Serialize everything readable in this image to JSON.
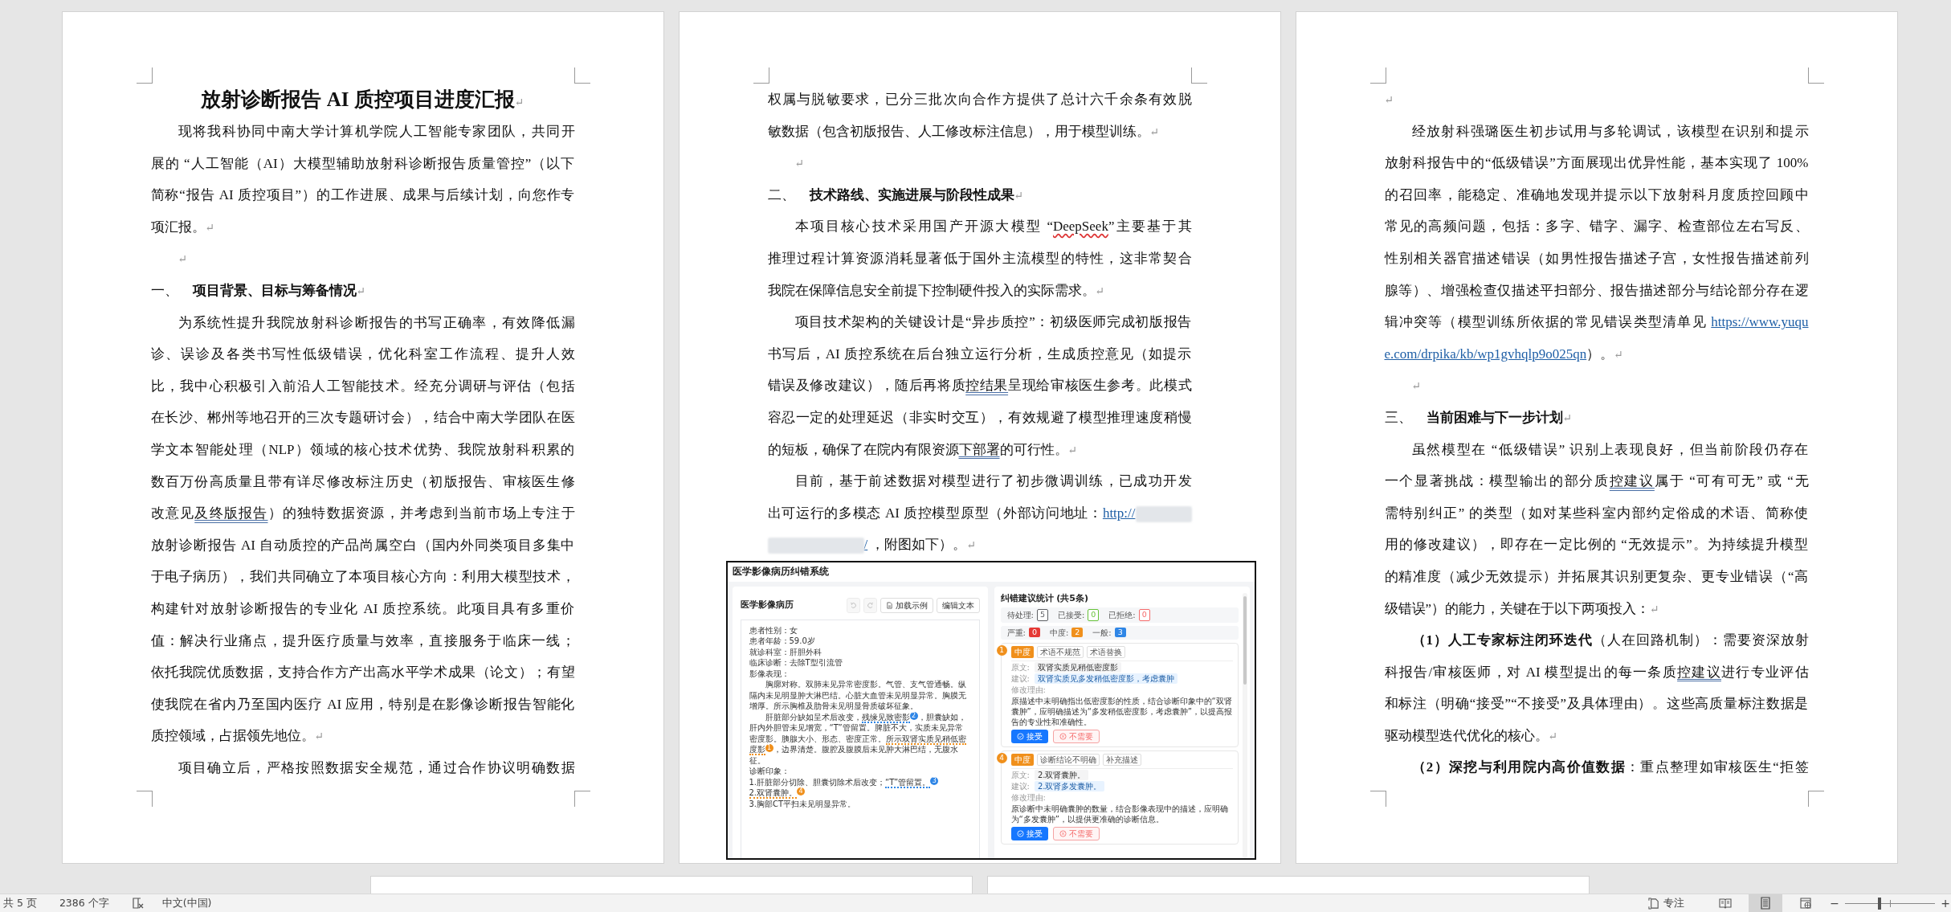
{
  "pages": [
    {
      "paragraphs": [
        {
          "kind": "title",
          "text": "放射诊断报告 AI 质控项目进度汇报",
          "end_mark": "↵"
        },
        {
          "kind": "body",
          "indent": true,
          "lines": [
            "现将我科协同中南大学计算机学院人工智能专家团队，共同开",
            "展的 “人工智能（AI）大模型辅助放射科诊断报告质量管控”（以下",
            "简称“报告 AI 质控项目”）的工作进展、成果与后续计划，向您作专",
            "项汇报。"
          ],
          "end_mark": "↵"
        },
        {
          "kind": "blank",
          "indent": true,
          "end_mark": "↵"
        },
        {
          "kind": "heading",
          "number": "一、",
          "text": "项目背景、目标与筹备情况",
          "end_mark": "↵"
        },
        {
          "kind": "body",
          "indent": true,
          "lines": [
            "为系统性提升我院放射科诊断报告的书写正确率，有效降低漏",
            "诊、误诊及各类书写性低级错误，优化科室工作流程、提升人效",
            "比，我中心积极引入前沿人工智能技术。经充分调研与评估（包括",
            "在长沙、郴州等地召开的三次专题研讨会），结合中南大学团队在医",
            "学文本智能处理（NLP）领域的核心技术优势、我院放射科积累的",
            "数百万份高质量且带有详尽修改标注历史（初版报告、审核医生修",
            [
              "改意见",
              {
                "text": "及终版报告",
                "kind": "grammar"
              },
              "）的独特数据资源，并考虑到当前市场上专注于"
            ],
            "放射诊断报告 AI 自动质控的产品尚属空白（国内外同类项目多集中",
            "于电子病历），我们共同确立了本项目核心方向：利用大模型技术，",
            "构建针对放射诊断报告的专业化 AI 质控系统。此项目具有多重价",
            "值：解决行业痛点，提升医疗质量与效率，直接服务于临床一线；",
            "依托我院优质数据，支持合作方产出高水平学术成果（论文）；有望",
            "使我院在省内乃至国内医疗 AI 应用，特别是在影像诊断报告智能化",
            "质控领域，占据领先地位。"
          ],
          "end_mark": "↵"
        },
        {
          "kind": "body",
          "indent": true,
          "lines": [
            "项目确立后，严格按照数据安全规范，通过合作协议明确数据"
          ]
        }
      ]
    },
    {
      "paragraphs": [
        {
          "kind": "body",
          "indent": false,
          "lines": [
            "权属与脱敏要求，已分三批次向合作方提供了总计六千余条有效脱",
            "敏数据（包含初版报告、人工修改标注信息），用于模型训练。"
          ],
          "end_mark": "↵"
        },
        {
          "kind": "blank",
          "indent": true,
          "end_mark": "↵"
        },
        {
          "kind": "heading",
          "number": "二、",
          "text": "技术路线、实施进展与阶段性成果",
          "end_mark": "↵"
        },
        {
          "kind": "body",
          "indent": true,
          "lines": [
            [
              "本项目核心技术采用国产开源大模型 “",
              {
                "text": "DeepSeek",
                "kind": "spelling"
              },
              "”主要基于其"
            ],
            "推理过程计算资源消耗显著低于国外主流模型的特性，这非常契合",
            "我院在保障信息安全前提下控制硬件投入的实际需求。"
          ],
          "end_mark": "↵"
        },
        {
          "kind": "body",
          "indent": true,
          "lines": [
            "项目技术架构的关键设计是“异步质控”：初级医师完成初版报告",
            "书写后，AI 质控系统在后台独立运行分析，生成质控意见（如提示",
            [
              "错误及修改建议），随后再将质",
              {
                "text": "控结果",
                "kind": "grammar"
              },
              "呈现给审核医生参考。此模式"
            ],
            "容忍一定的处理延迟（非实时交互），有效规避了模型推理速度稍慢",
            [
              "的短板，确保了在院内有限资源",
              {
                "text": "下部署",
                "kind": "grammar"
              },
              "的可行性。"
            ]
          ],
          "end_mark": "↵"
        },
        {
          "kind": "body",
          "indent": true,
          "lines": [
            "目前，基于前述数据对模型进行了初步微调训练，已成功开发",
            [
              "出可运行的多模态 AI 质控模型原型（外部访问地址：",
              {
                "text": "http://",
                "kind": "link"
              },
              {
                "kind": "blur"
              }
            ],
            [
              {
                "kind": "blur"
              },
              {
                "text": "/",
                "kind": "link"
              },
              "  ，附图如下）。"
            ]
          ],
          "end_mark": "↵"
        }
      ],
      "figure": {
        "app_title": "医学影像病历纠错系统",
        "editor": {
          "title": "医学影像病历",
          "buttons": [
            {
              "kind": "undo",
              "disabled": true
            },
            {
              "kind": "redo",
              "disabled": true
            },
            {
              "kind": "load",
              "label": "加载示例",
              "disabled": false
            },
            {
              "kind": "edit",
              "label": "编辑文本",
              "disabled": false
            }
          ],
          "lines": [
            {
              "indent": false,
              "parts": [
                {
                  "text": "患者性别：女",
                  "flag": false
                }
              ]
            },
            {
              "indent": false,
              "parts": [
                {
                  "text": "患者年龄：59.0岁",
                  "flag": false
                }
              ]
            },
            {
              "indent": false,
              "parts": [
                {
                  "text": "就诊科室：肝胆外科",
                  "flag": false
                }
              ]
            },
            {
              "indent": false,
              "parts": [
                {
                  "text": "临床诊断：去除T型引流管",
                  "flag": false
                }
              ]
            },
            {
              "indent": false,
              "parts": [
                {
                  "text": "影像表现：",
                  "flag": false
                }
              ]
            },
            {
              "indent": true,
              "parts": [
                {
                  "text": "胸廓对称。双肺未见异常密度影。气管、支气管通畅。纵隔内未见明显肿大淋巴结。心脏大血管未见明显异常。胸膜无增厚。所示胸椎及肋骨未见明显骨质破坏征象。",
                  "flag": false
                }
              ]
            },
            {
              "indent": true,
              "parts": [
                {
                  "text": "肝脏部分缺如呈术后改变，",
                  "flag": false
                },
                {
                  "text": "残缘见致密影",
                  "flag": true
                },
                {
                  "badge": "2",
                  "color": "#2f86e6"
                },
                {
                  "text": "，胆囊缺如，肝内外胆管未见增宽，“T”管留置。脾脏不大，实质未见异常密度影。胰腺大小、形态、密度正常。",
                  "flag": false
                },
                {
                  "text": "所示双肾实质见稍低密度影",
                  "flag": true
                },
                {
                  "badge": "1",
                  "color": "#f0901c"
                },
                {
                  "text": "，边界清楚。腹腔及腹膜后未见肿大淋巴结，无腹水征。",
                  "flag": false
                }
              ]
            },
            {
              "indent": false,
              "parts": [
                {
                  "text": "诊断印象：",
                  "flag": false
                }
              ]
            },
            {
              "indent": false,
              "parts": [
                {
                  "text": "1.肝脏部分切除、胆囊切除术后改变；",
                  "flag": false
                },
                {
                  "text": "“T”管留置。",
                  "flag": true
                },
                {
                  "badge": "3",
                  "color": "#2f86e6"
                }
              ]
            },
            {
              "indent": false,
              "parts": [
                {
                  "text": "2.双肾囊肿。",
                  "flag": true
                },
                {
                  "badge": "4",
                  "color": "#f0901c"
                }
              ]
            },
            {
              "indent": false,
              "parts": [
                {
                  "text": "3.胸部CT平扫未见明显异常。",
                  "flag": false
                }
              ]
            }
          ]
        },
        "suggestions": {
          "title": "纠错建议统计 (共5条)",
          "stats": [
            {
              "label": "待处理:",
              "count": "5",
              "color": "#606266"
            },
            {
              "label": "已接受:",
              "count": "0",
              "color": "#67c23a"
            },
            {
              "label": "已拒绝:",
              "count": "0",
              "color": "#f56c6c"
            }
          ],
          "severity": [
            {
              "label": "严重:",
              "count": "0",
              "color": "#e53935"
            },
            {
              "label": "中度:",
              "count": "2",
              "color": "#f0901c"
            },
            {
              "label": "一般:",
              "count": "3",
              "color": "#2f86e6"
            }
          ],
          "cards": [
            {
              "number": "1",
              "color": "#f0901c",
              "severity": "中度",
              "tags": [
                "术语不规范",
                "术语替换"
              ],
              "original_label": "原文:",
              "original": "双肾实质见稍低密度影",
              "suggest_label": "建议:",
              "suggestion": "双肾实质见多发稍低密度影，考虑囊肿",
              "reason_label": "修改理由:",
              "reason": "原描述中未明确指出低密度影的性质，结合诊断印象中的“双肾囊肿”，应明确描述为“多发稍低密度影，考虑囊肿”，以提高报告的专业性和准确性。",
              "accept": "接受",
              "reject": "不需要"
            },
            {
              "number": "4",
              "color": "#f0901c",
              "severity": "中度",
              "tags": [
                "诊断结论不明确",
                "补充描述"
              ],
              "original_label": "原文:",
              "original": "2.双肾囊肿。",
              "suggest_label": "建议:",
              "suggestion": "2.双肾多发囊肿。",
              "reason_label": "修改理由:",
              "reason": "原诊断中未明确囊肿的数量，结合影像表现中的描述，应明确为“多发囊肿”，以提供更准确的诊断信息。",
              "accept": "接受",
              "reject": "不需要"
            }
          ]
        }
      }
    },
    {
      "paragraphs": [
        {
          "kind": "blank",
          "indent": false,
          "end_mark": "↵"
        },
        {
          "kind": "body",
          "indent": true,
          "lines": [
            "经放射科强璐医生初步试用与多轮调试，该模型在识别和提示",
            "放射科报告中的“低级错误”方面展现出优异性能，基本实现了 100%",
            "的召回率，能稳定、准确地发现并提示以下放射科月度质控回顾中",
            "常见的高频问题，包括：多字、错字、漏字、检查部位左右写反、",
            "性别相关器官描述错误（如男性报告描述子宫，女性报告描述前列",
            "腺等）、增强检查仅描述平扫部分、报告描述部分与结论部分存在逻",
            [
              "辑冲突等（模型训练所依据的常见错误类型清单见 ",
              {
                "text": "https://www.yuqu",
                "kind": "link"
              }
            ],
            [
              {
                "text": "e.com/drpika/kb/wp1gvhqlp9o025qn",
                "kind": "link"
              },
              "）。"
            ]
          ],
          "end_mark": "↵"
        },
        {
          "kind": "blank",
          "indent": true,
          "end_mark": "↵"
        },
        {
          "kind": "heading",
          "number": "三、",
          "text": "当前困难与下一步计划",
          "end_mark": "↵"
        },
        {
          "kind": "body",
          "indent": true,
          "lines": [
            "虽然模型在 “低级错误” 识别上表现良好，但当前阶段仍存在",
            [
              "一个显著挑战：模型输出的部分质",
              {
                "text": "控建议",
                "kind": "grammar"
              },
              "属于 “可有可无” 或 “无"
            ],
            "需特别纠正” 的类型（如对某些科室内部约定俗成的术语、简称使",
            "用的修改建议），即存在一定比例的 “无效提示”。为持续提升模型",
            "的精准度（减少无效提示）并拓展其识别更复杂、更专业错误（“高",
            "级错误”）的能力，关键在于以下两项投入："
          ],
          "end_mark": "↵"
        },
        {
          "kind": "body",
          "indent": true,
          "lines": [
            [
              {
                "text": "（1）人工专家标注闭环迭代",
                "kind": "bold"
              },
              "（人在回路机制）：需要资深放射"
            ],
            [
              "科报告/审核医师，对 AI 模型提出的每一条质",
              {
                "text": "控建议",
                "kind": "grammar"
              },
              "进行专业评估"
            ],
            "和标注（明确“接受”“不接受”及具体理由）。这些高质量标注数据是",
            "驱动模型迭代优化的核心。"
          ],
          "end_mark": "↵"
        },
        {
          "kind": "body",
          "indent": true,
          "lines": [
            [
              {
                "text": "（2）深挖与利用院内高价值数据",
                "kind": "bold"
              },
              "：重点整理如审核医生“拒签"
            ]
          ]
        }
      ]
    }
  ],
  "status_bar": {
    "page_count": "共 5 页",
    "word_count": "2386 个字",
    "language": "中文(中国)",
    "focus": "专注",
    "views": [
      {
        "kind": "read",
        "selected": false
      },
      {
        "kind": "print",
        "selected": true
      },
      {
        "kind": "web",
        "selected": false
      }
    ],
    "zoom_out": "−",
    "zoom_in": "+",
    "zoom": {
      "level": 0.38
    }
  }
}
